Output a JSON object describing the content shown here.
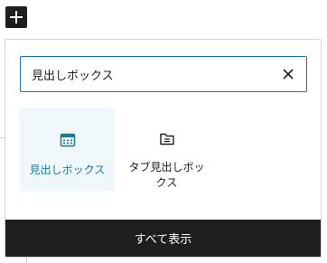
{
  "search": {
    "value": "見出しボックス"
  },
  "blocks": [
    {
      "label": "見出しボックス",
      "icon": "calendar-icon",
      "selected": true
    },
    {
      "label": "タブ見出しボックス",
      "icon": "folder-icon",
      "selected": false
    }
  ],
  "footer": {
    "show_all_label": "すべて表示"
  },
  "colors": {
    "accent": "#1b7a9a",
    "highlight_bg": "#f0f7fb",
    "dark": "#1e1e1e"
  }
}
